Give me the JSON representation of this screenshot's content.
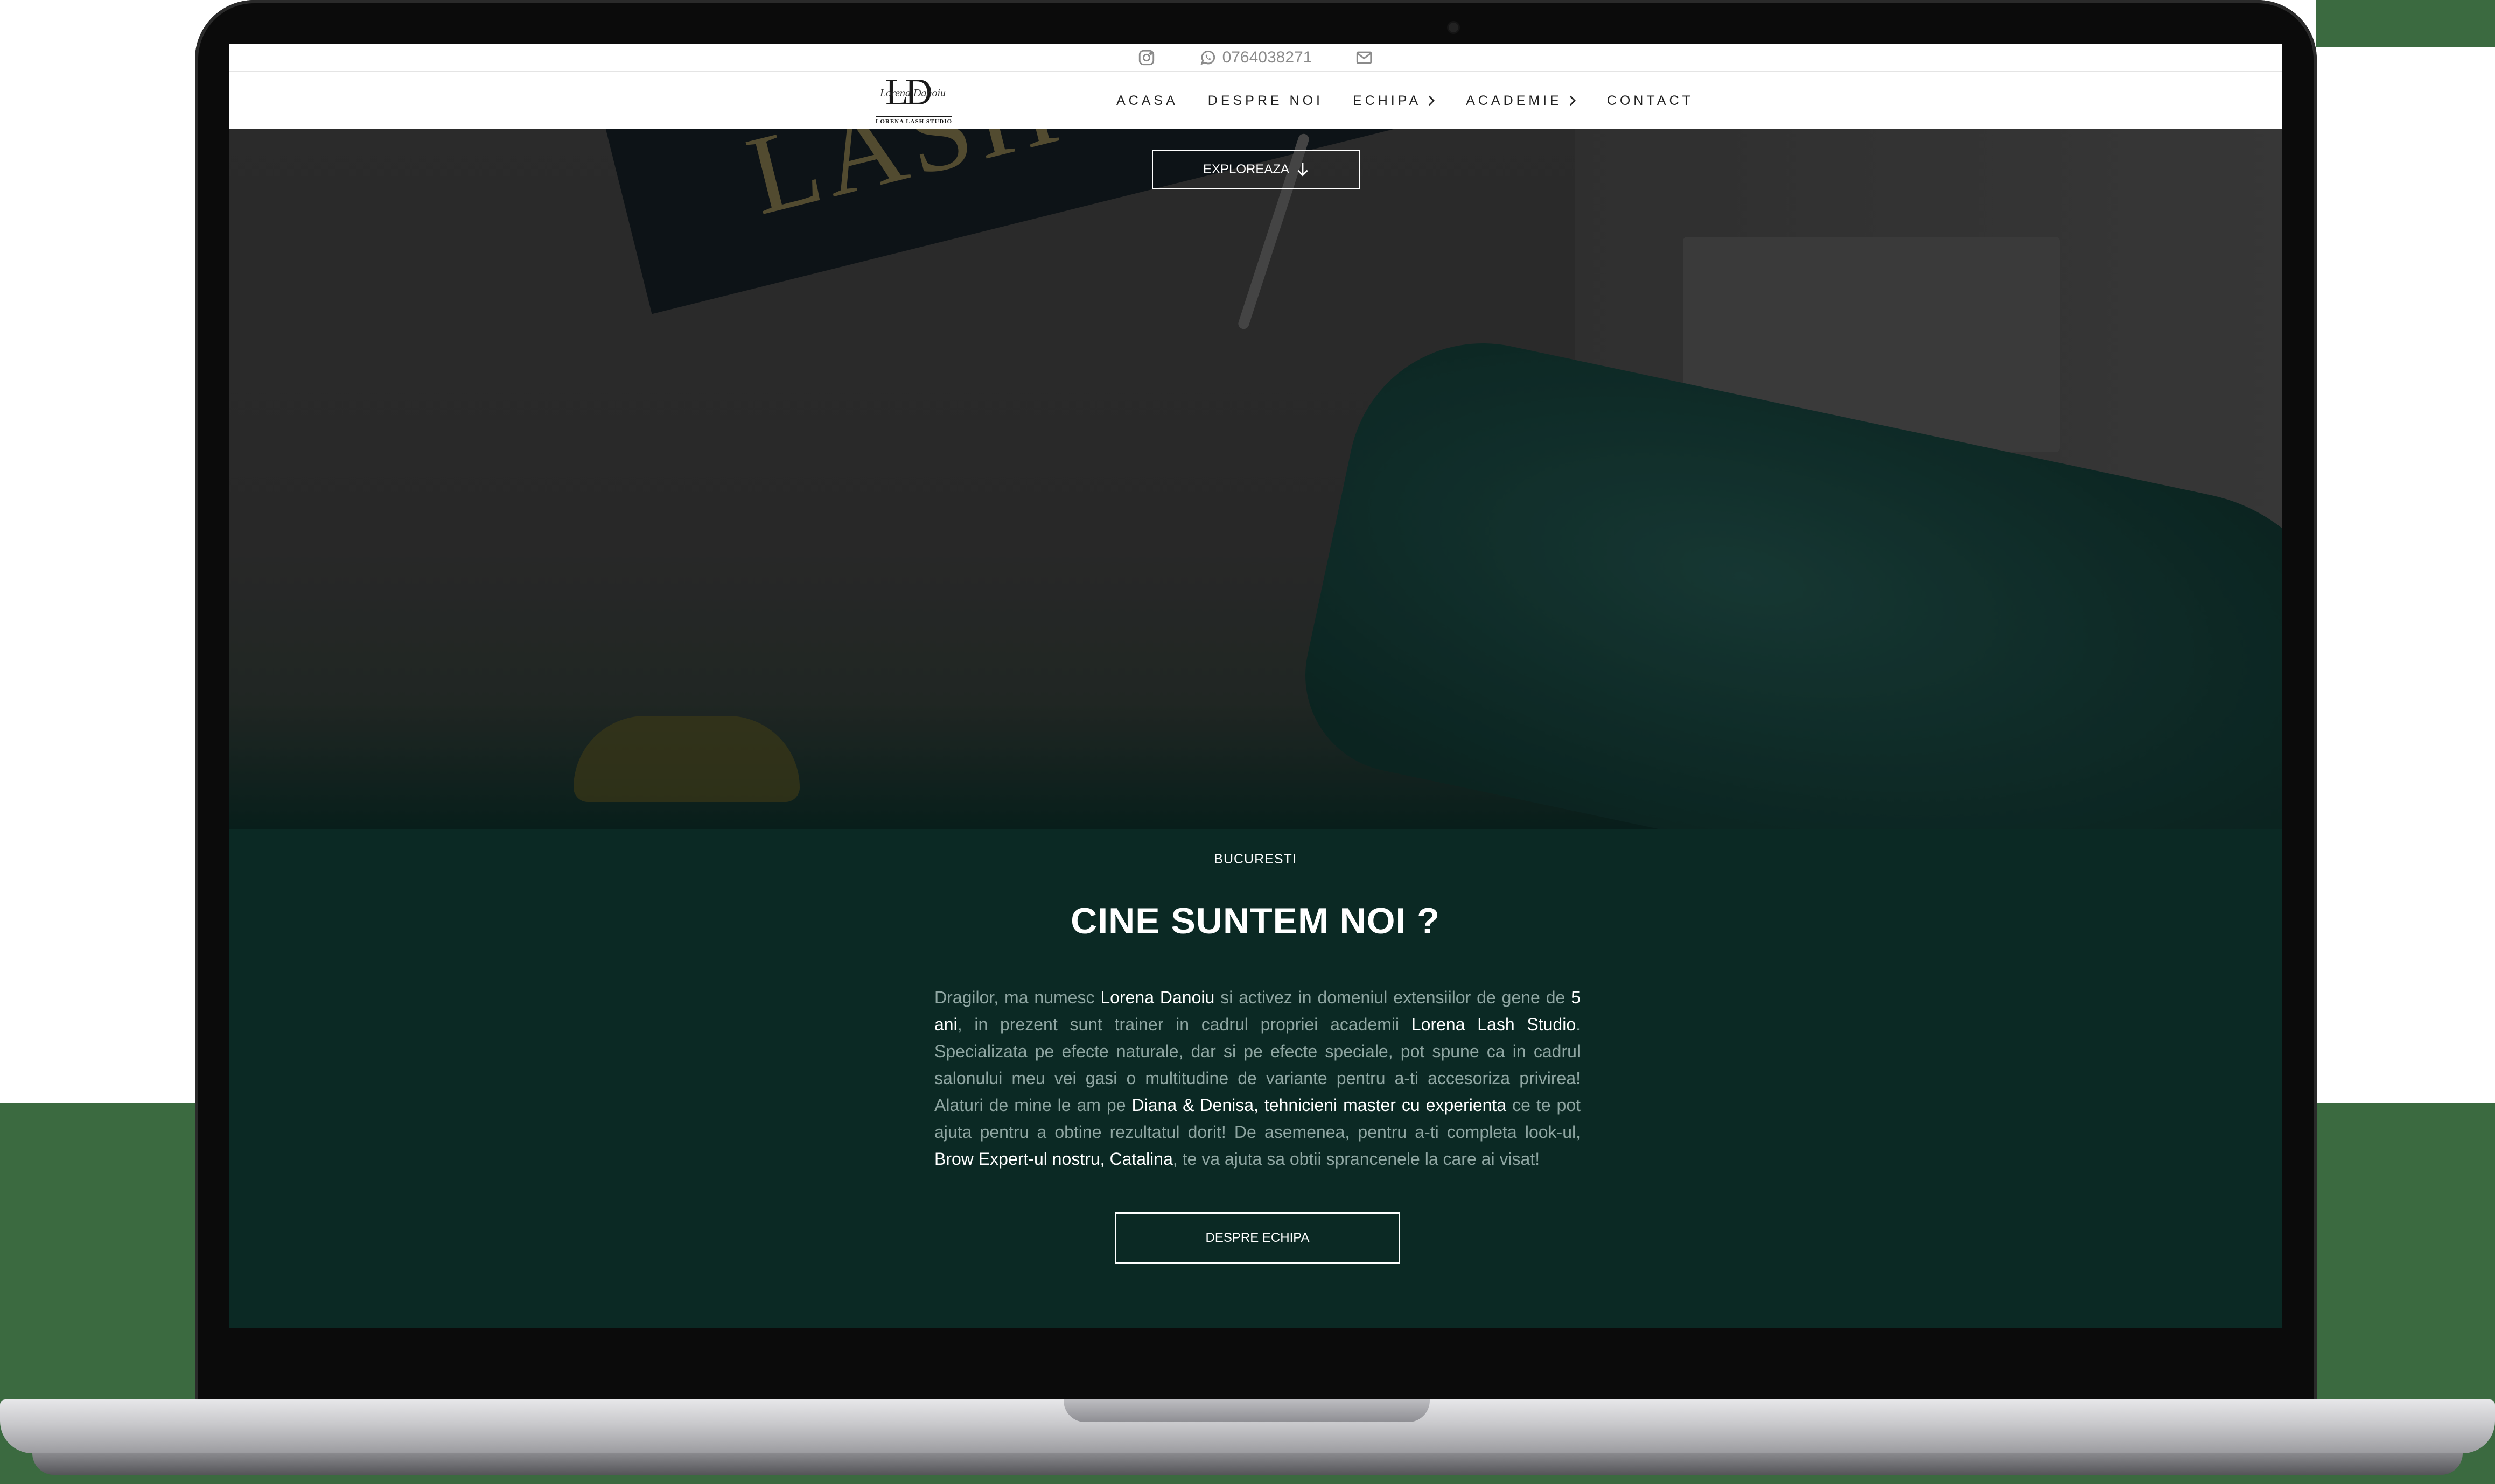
{
  "topbar": {
    "instagram_icon": "instagram-icon",
    "phone": "0764038271",
    "whatsapp_icon": "whatsapp-icon",
    "email_icon": "mail-icon"
  },
  "brand": {
    "monogram": "LD",
    "script": "Lorena Danoiu",
    "name": "LORENA LASH STUDIO"
  },
  "nav": {
    "items": [
      {
        "label": "ACASA"
      },
      {
        "label": "DESPRE NOI"
      },
      {
        "label": "ECHIPA"
      },
      {
        "label": "ACADEMIE"
      },
      {
        "label": "CONTACT"
      }
    ]
  },
  "hero": {
    "sign_text": "LASH ST",
    "explore_label": "EXPLOREAZA"
  },
  "about": {
    "location": "BUCURESTI",
    "heading": "CINE SUNTEM NOI ?",
    "paragraph": [
      {
        "t": "Dragilor, ma numesc ",
        "hl": false
      },
      {
        "t": "Lorena Danoiu",
        "hl": true
      },
      {
        "t": " si activez in domeniul extensiilor de gene de ",
        "hl": false
      },
      {
        "t": "5 ani",
        "hl": true
      },
      {
        "t": ", in prezent sunt trainer in cadrul propriei academii ",
        "hl": false
      },
      {
        "t": "Lorena Lash Studio",
        "hl": true
      },
      {
        "t": ". Specializata pe efecte naturale, dar si pe efecte speciale, pot spune ca in cadrul salonului meu vei gasi o multitudine de variante pentru a-ti accesoriza privirea! Alaturi de mine le am pe ",
        "hl": false
      },
      {
        "t": "Diana & Denisa, tehnicieni master cu experienta",
        "hl": true
      },
      {
        "t": " ce te pot ajuta pentru a obtine rezultatul dorit! De asemenea, pentru a-ti completa look-ul, ",
        "hl": false
      },
      {
        "t": "Brow Expert-ul nostru, Catalina",
        "hl": true
      },
      {
        "t": ", te va ajuta sa obtii sprancenele la care ai visat!",
        "hl": false
      }
    ],
    "team_button": "DESPRE ECHIPA"
  },
  "colors": {
    "section_bg": "#0b2924",
    "page_accent": "#3b6a40",
    "text_muted": "#8fa6a2"
  }
}
